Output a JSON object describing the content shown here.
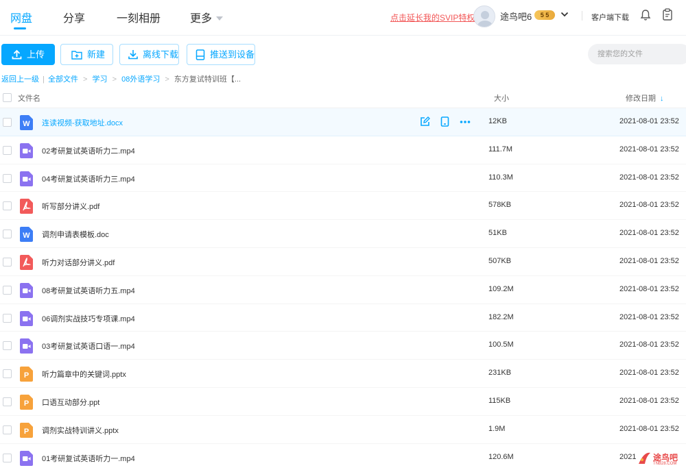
{
  "nav": {
    "tabs": [
      {
        "label": "网盘"
      },
      {
        "label": "分享"
      },
      {
        "label": "一刻相册"
      },
      {
        "label": "更多"
      }
    ],
    "svip_link": "点击延长我的SVIP特权",
    "username": "途鸟吧6",
    "vip_level": "5 5",
    "client_download": "客户端下载"
  },
  "toolbar": {
    "upload": "上传",
    "new": "新建",
    "offline_download": "离线下载",
    "push_device": "推送到设备",
    "search_placeholder": "搜索您的文件"
  },
  "breadcrumb": {
    "back": "返回上一级",
    "separator": "|",
    "items": [
      "全部文件",
      "学习",
      "08外语学习"
    ],
    "current": "东方复试特训班【..."
  },
  "table": {
    "col_name": "文件名",
    "col_size": "大小",
    "col_date": "修改日期",
    "sort_arrow": "↓",
    "rows": [
      {
        "name": "连读视频-获取地址.docx",
        "size": "12KB",
        "date": "2021-08-01 23:52",
        "type": "word"
      },
      {
        "name": "02考研复试英语听力二.mp4",
        "size": "111.7M",
        "date": "2021-08-01 23:52",
        "type": "video"
      },
      {
        "name": "04考研复试英语听力三.mp4",
        "size": "110.3M",
        "date": "2021-08-01 23:52",
        "type": "video"
      },
      {
        "name": "听写部分讲义.pdf",
        "size": "578KB",
        "date": "2021-08-01 23:52",
        "type": "pdf"
      },
      {
        "name": "调剂申请表模板.doc",
        "size": "51KB",
        "date": "2021-08-01 23:52",
        "type": "word"
      },
      {
        "name": "听力对话部分讲义.pdf",
        "size": "507KB",
        "date": "2021-08-01 23:52",
        "type": "pdf"
      },
      {
        "name": "08考研复试英语听力五.mp4",
        "size": "109.2M",
        "date": "2021-08-01 23:52",
        "type": "video"
      },
      {
        "name": "06调剂实战技巧专项课.mp4",
        "size": "182.2M",
        "date": "2021-08-01 23:52",
        "type": "video"
      },
      {
        "name": "03考研复试英语口语一.mp4",
        "size": "100.5M",
        "date": "2021-08-01 23:52",
        "type": "video"
      },
      {
        "name": "听力篇章中的关键词.pptx",
        "size": "231KB",
        "date": "2021-08-01 23:52",
        "type": "ppt"
      },
      {
        "name": "口语互动部分.ppt",
        "size": "115KB",
        "date": "2021-08-01 23:52",
        "type": "ppt"
      },
      {
        "name": "调剂实战特训讲义.pptx",
        "size": "1.9M",
        "date": "2021-08-01 23:52",
        "type": "ppt"
      },
      {
        "name": "01考研复试英语听力一.mp4",
        "size": "120.6M",
        "date": "2021",
        "type": "video"
      }
    ]
  },
  "file_type_colors": {
    "word": "#3d7ef6",
    "video": "#8b72f0",
    "pdf": "#f25a5a",
    "ppt": "#f7a23b"
  },
  "icon_letters": {
    "word": "W",
    "pdf": "",
    "ppt": "P",
    "video": ""
  },
  "accent_color": "#06a7ff",
  "watermark": {
    "text": "途鸟吧",
    "sub": "TNB28.COM"
  }
}
